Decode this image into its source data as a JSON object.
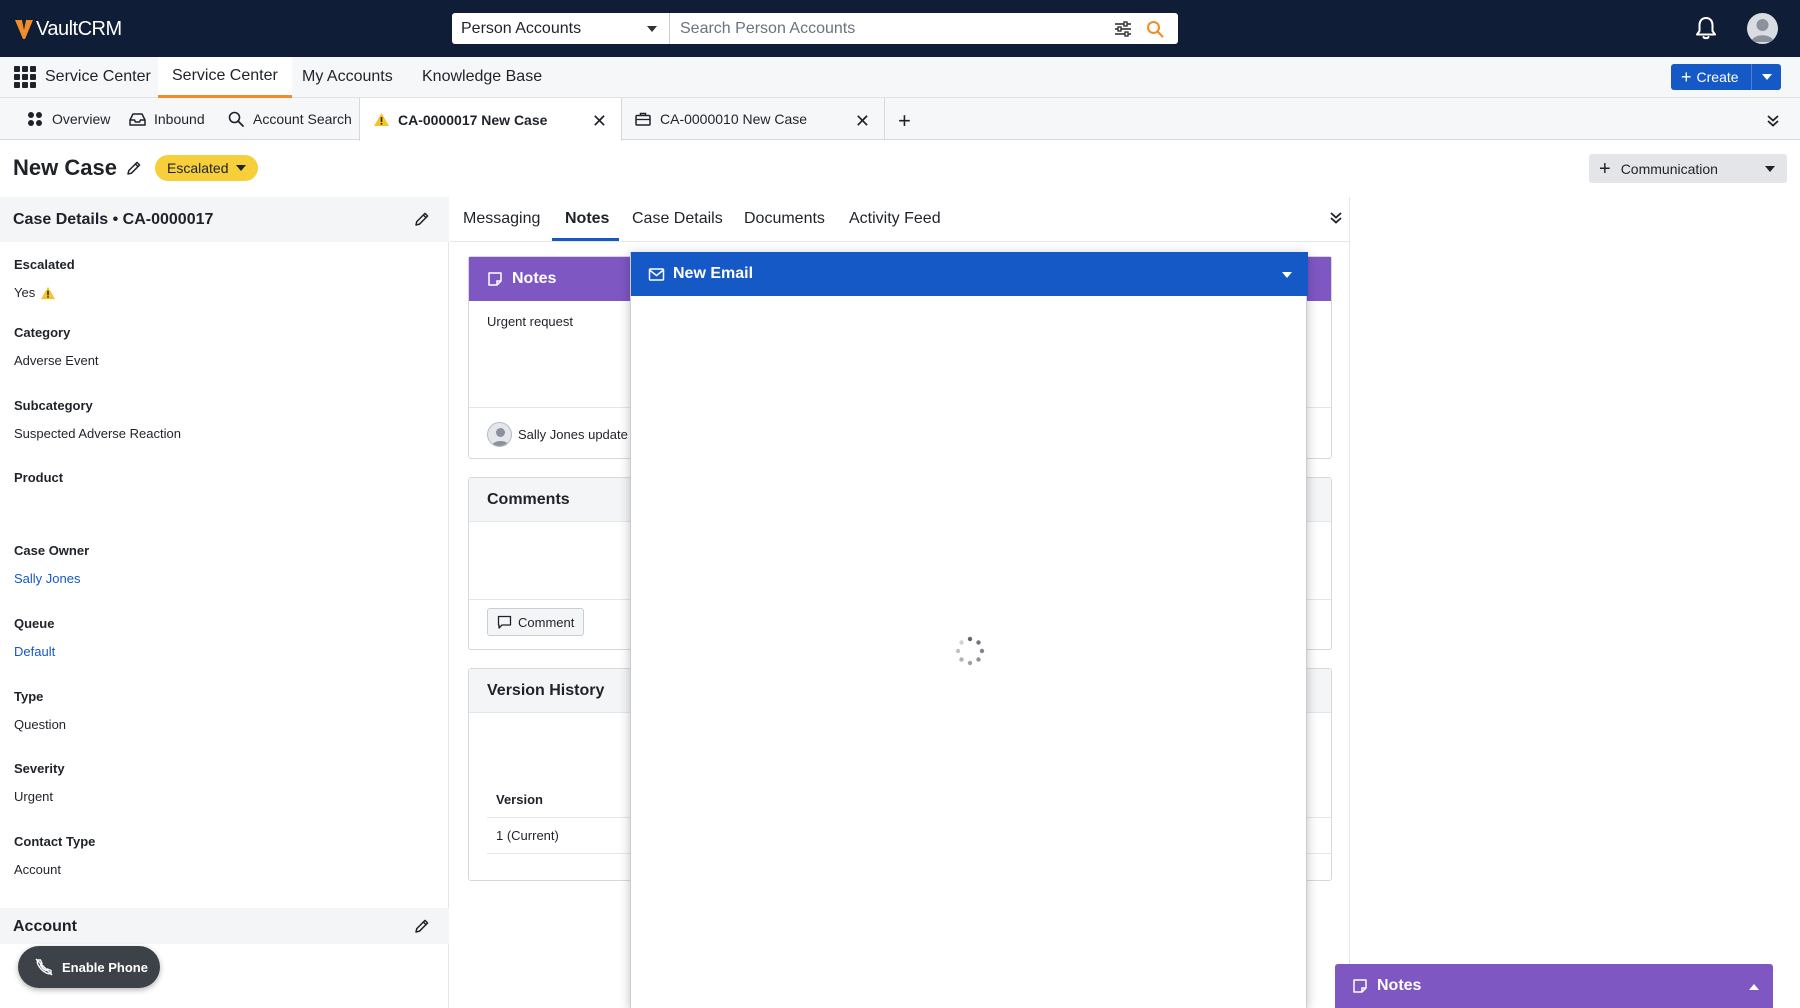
{
  "header": {
    "logo_text": "VaultCRM",
    "search_scope": "Person Accounts",
    "search_placeholder": "Search Person Accounts"
  },
  "nav": {
    "app_name": "Service Center",
    "tabs": [
      {
        "label": "Service Center",
        "active": true
      },
      {
        "label": "My Accounts",
        "active": false
      },
      {
        "label": "Knowledge Base",
        "active": false
      }
    ],
    "create_label": "Create"
  },
  "workspace_tabs": [
    {
      "label": "Overview",
      "icon": "grid-icon"
    },
    {
      "label": "Inbound",
      "icon": "inbox-icon"
    },
    {
      "label": "Account Search",
      "icon": "search-icon"
    },
    {
      "label": "CA-0000017 New Case",
      "icon": "warning-icon",
      "active": true
    },
    {
      "label": "CA-0000010 New Case",
      "icon": "briefcase-icon"
    }
  ],
  "record": {
    "title": "New Case",
    "status": "Escalated",
    "communication_label": "Communication"
  },
  "case_details": {
    "title": "Case Details • CA-0000017",
    "fields": [
      {
        "label": "Escalated",
        "value": "Yes"
      },
      {
        "label": "Category",
        "value": "Adverse Event"
      },
      {
        "label": "Subcategory",
        "value": "Suspected Adverse Reaction"
      },
      {
        "label": "Product",
        "value": ""
      },
      {
        "label": "Case Owner",
        "value": "Sally Jones"
      },
      {
        "label": "Queue",
        "value": "Default"
      },
      {
        "label": "Type",
        "value": "Question"
      },
      {
        "label": "Severity",
        "value": "Urgent"
      },
      {
        "label": "Contact Type",
        "value": "Account"
      }
    ],
    "account_title": "Account"
  },
  "enable_phone_label": "Enable Phone",
  "center_tabs": [
    {
      "label": "Messaging"
    },
    {
      "label": "Notes",
      "active": true
    },
    {
      "label": "Case Details"
    },
    {
      "label": "Documents"
    },
    {
      "label": "Activity Feed"
    }
  ],
  "notes_card": {
    "title": "Notes",
    "text": "Urgent request",
    "updated_by": "Sally Jones update"
  },
  "comments_card": {
    "title": "Comments",
    "button_label": "Comment"
  },
  "version_history": {
    "title": "Version History",
    "column": "Version",
    "row": "1 (Current)"
  },
  "email_modal": {
    "title": "New Email"
  },
  "notes_float": {
    "title": "Notes"
  },
  "colors": {
    "topbar": "#0f1d36",
    "accent_blue": "#1559c6",
    "notes_purple": "#7e57c2",
    "escalated_yellow": "#f6cf3a",
    "nav_underline": "#f28c28"
  }
}
